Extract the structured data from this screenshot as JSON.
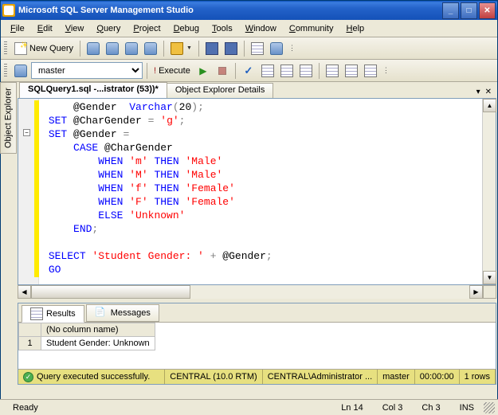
{
  "window": {
    "title": "Microsoft SQL Server Management Studio"
  },
  "menubar": [
    {
      "label": "File",
      "u": 0
    },
    {
      "label": "Edit",
      "u": 0
    },
    {
      "label": "View",
      "u": 0
    },
    {
      "label": "Query",
      "u": 0
    },
    {
      "label": "Project",
      "u": 0
    },
    {
      "label": "Debug",
      "u": 0
    },
    {
      "label": "Tools",
      "u": 0
    },
    {
      "label": "Window",
      "u": 0
    },
    {
      "label": "Community",
      "u": 0
    },
    {
      "label": "Help",
      "u": 0
    }
  ],
  "toolbar1": {
    "new_query": "New Query"
  },
  "toolbar2": {
    "database": "master",
    "execute": "Execute"
  },
  "left_tab": "Object Explorer",
  "tabs": {
    "active": "SQLQuery1.sql -...istrator (53))*",
    "other": "Object Explorer Details"
  },
  "code_lines": [
    {
      "indent": "     ",
      "tokens": [
        {
          "t": "@Gender  ",
          "c": ""
        },
        {
          "t": "Varchar",
          "c": "kw"
        },
        {
          "t": "(",
          "c": "op"
        },
        {
          "t": "20",
          "c": "num"
        },
        {
          "t": ")",
          "c": "op"
        },
        {
          "t": ";",
          "c": "op"
        }
      ]
    },
    {
      "indent": " ",
      "tokens": [
        {
          "t": "SET",
          "c": "kw"
        },
        {
          "t": " @CharGender ",
          "c": ""
        },
        {
          "t": "=",
          "c": "op"
        },
        {
          "t": " ",
          "c": ""
        },
        {
          "t": "'g'",
          "c": "str"
        },
        {
          "t": ";",
          "c": "op"
        }
      ]
    },
    {
      "indent": " ",
      "tokens": [
        {
          "t": "SET",
          "c": "kw"
        },
        {
          "t": " @Gender ",
          "c": ""
        },
        {
          "t": "=",
          "c": "op"
        }
      ]
    },
    {
      "indent": "     ",
      "tokens": [
        {
          "t": "CASE",
          "c": "kw"
        },
        {
          "t": " @CharGender",
          "c": ""
        }
      ]
    },
    {
      "indent": "         ",
      "tokens": [
        {
          "t": "WHEN",
          "c": "kw"
        },
        {
          "t": " ",
          "c": ""
        },
        {
          "t": "'m'",
          "c": "str"
        },
        {
          "t": " ",
          "c": ""
        },
        {
          "t": "THEN",
          "c": "kw"
        },
        {
          "t": " ",
          "c": ""
        },
        {
          "t": "'Male'",
          "c": "str"
        }
      ]
    },
    {
      "indent": "         ",
      "tokens": [
        {
          "t": "WHEN",
          "c": "kw"
        },
        {
          "t": " ",
          "c": ""
        },
        {
          "t": "'M'",
          "c": "str"
        },
        {
          "t": " ",
          "c": ""
        },
        {
          "t": "THEN",
          "c": "kw"
        },
        {
          "t": " ",
          "c": ""
        },
        {
          "t": "'Male'",
          "c": "str"
        }
      ]
    },
    {
      "indent": "         ",
      "tokens": [
        {
          "t": "WHEN",
          "c": "kw"
        },
        {
          "t": " ",
          "c": ""
        },
        {
          "t": "'f'",
          "c": "str"
        },
        {
          "t": " ",
          "c": ""
        },
        {
          "t": "THEN",
          "c": "kw"
        },
        {
          "t": " ",
          "c": ""
        },
        {
          "t": "'Female'",
          "c": "str"
        }
      ]
    },
    {
      "indent": "         ",
      "tokens": [
        {
          "t": "WHEN",
          "c": "kw"
        },
        {
          "t": " ",
          "c": ""
        },
        {
          "t": "'F'",
          "c": "str"
        },
        {
          "t": " ",
          "c": ""
        },
        {
          "t": "THEN",
          "c": "kw"
        },
        {
          "t": " ",
          "c": ""
        },
        {
          "t": "'Female'",
          "c": "str"
        }
      ]
    },
    {
      "indent": "         ",
      "tokens": [
        {
          "t": "ELSE",
          "c": "kw"
        },
        {
          "t": " ",
          "c": ""
        },
        {
          "t": "'Unknown'",
          "c": "str"
        }
      ]
    },
    {
      "indent": "     ",
      "tokens": [
        {
          "t": "END",
          "c": "kw"
        },
        {
          "t": ";",
          "c": "op"
        }
      ]
    },
    {
      "indent": "",
      "tokens": []
    },
    {
      "indent": " ",
      "tokens": [
        {
          "t": "SELECT",
          "c": "kw"
        },
        {
          "t": " ",
          "c": ""
        },
        {
          "t": "'Student Gender: '",
          "c": "str"
        },
        {
          "t": " ",
          "c": ""
        },
        {
          "t": "+",
          "c": "op"
        },
        {
          "t": " @Gender",
          "c": ""
        },
        {
          "t": ";",
          "c": "op"
        }
      ]
    },
    {
      "indent": " ",
      "tokens": [
        {
          "t": "GO",
          "c": "kw"
        }
      ]
    }
  ],
  "results": {
    "tab_results": "Results",
    "tab_messages": "Messages",
    "header": "(No column name)",
    "row_number": "1",
    "value": "Student Gender: Unknown"
  },
  "status_strip": {
    "message": "Query executed successfully.",
    "server": "CENTRAL (10.0 RTM)",
    "user": "CENTRAL\\Administrator ...",
    "database": "master",
    "elapsed": "00:00:00",
    "rows": "1 rows"
  },
  "statusbar": {
    "ready": "Ready",
    "line": "Ln 14",
    "col": "Col 3",
    "ch": "Ch 3",
    "ins": "INS"
  }
}
